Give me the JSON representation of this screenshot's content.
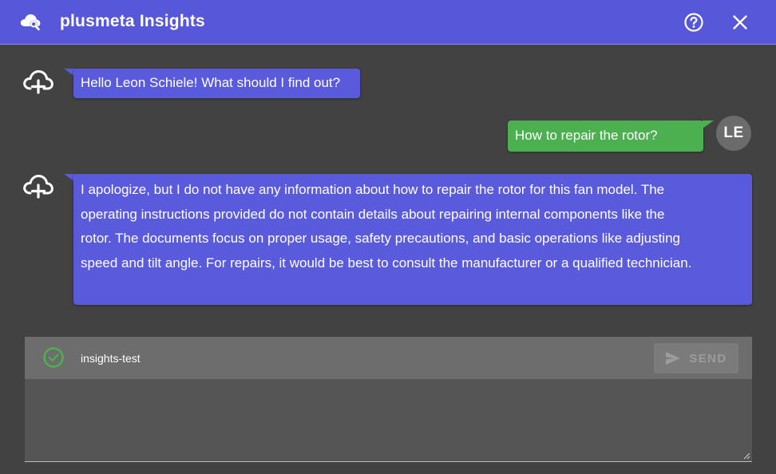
{
  "header": {
    "title": "plusmeta Insights",
    "logo_icon": "cloud-search-icon",
    "help_icon": "help-circle-icon",
    "close_icon": "close-icon",
    "background_color": "#5757d9"
  },
  "messages": [
    {
      "sender": "bot",
      "avatar_icon": "cloud-plus-icon",
      "text": "Hello Leon Schiele! What should I find out?"
    },
    {
      "sender": "user",
      "avatar_initials": "LE",
      "text": "How to repair the rotor?"
    },
    {
      "sender": "bot",
      "avatar_icon": "cloud-plus-icon",
      "lines": [
        "I apologize, but I do not have any information about how to repair the rotor for this fan model. The",
        "operating instructions provided do not contain details about repairing internal components like the",
        "rotor. The documents focus on proper usage, safety precautions, and basic operations like adjusting",
        "speed and tilt angle. For repairs, it would be best to consult the manufacturer or a qualified technician."
      ]
    }
  ],
  "composer": {
    "status_icon": "check-circle-icon",
    "workspace_label": "insights-test",
    "send_label": "SEND",
    "send_icon": "send-icon",
    "input_value": "",
    "input_placeholder": ""
  },
  "colors": {
    "bot_bubble": "#5a5adc",
    "user_bubble": "#4caf50",
    "status_ok": "#4caf50",
    "background": "#424242"
  }
}
